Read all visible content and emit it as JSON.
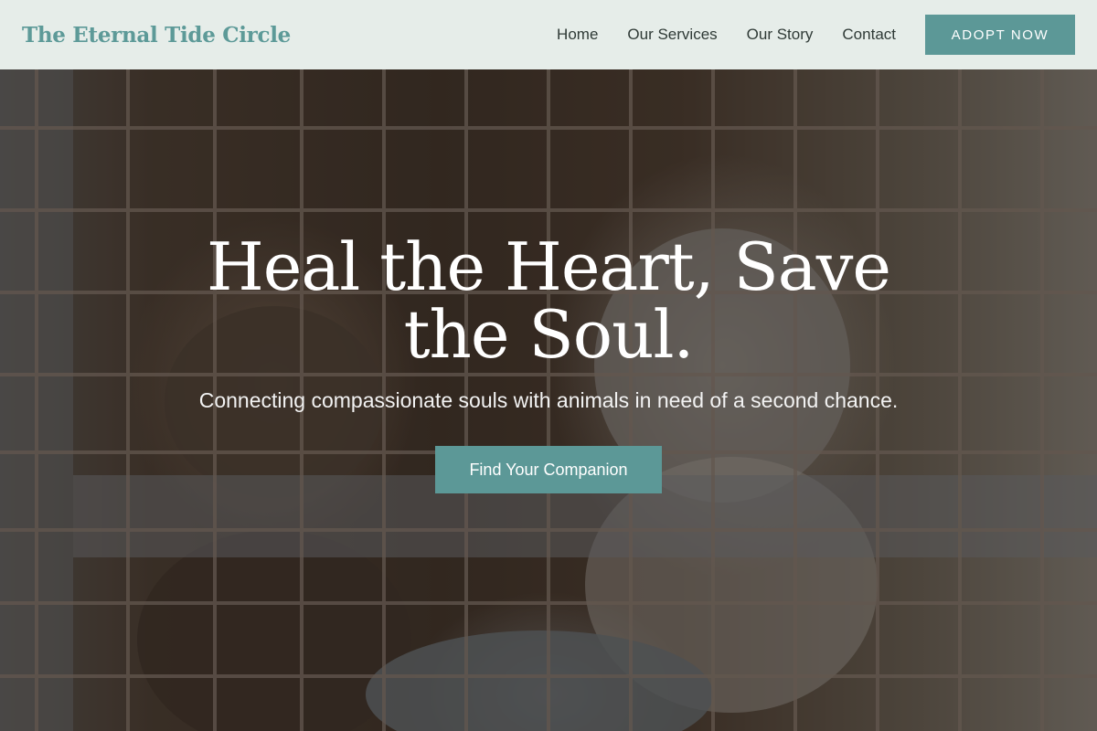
{
  "header": {
    "brand": "The Eternal Tide Circle",
    "nav": [
      {
        "label": "Home"
      },
      {
        "label": "Our Services"
      },
      {
        "label": "Our Story"
      },
      {
        "label": "Contact"
      }
    ],
    "adopt_label": "ADOPT NOW"
  },
  "hero": {
    "title": "Heal the Heart, Save the Soul.",
    "subtitle": "Connecting compassionate souls with animals in need of a second chance.",
    "cta_label": "Find Your Companion"
  },
  "colors": {
    "accent": "#5c9897",
    "brand_text": "#5d9a98",
    "header_bg": "#e6ede9"
  }
}
